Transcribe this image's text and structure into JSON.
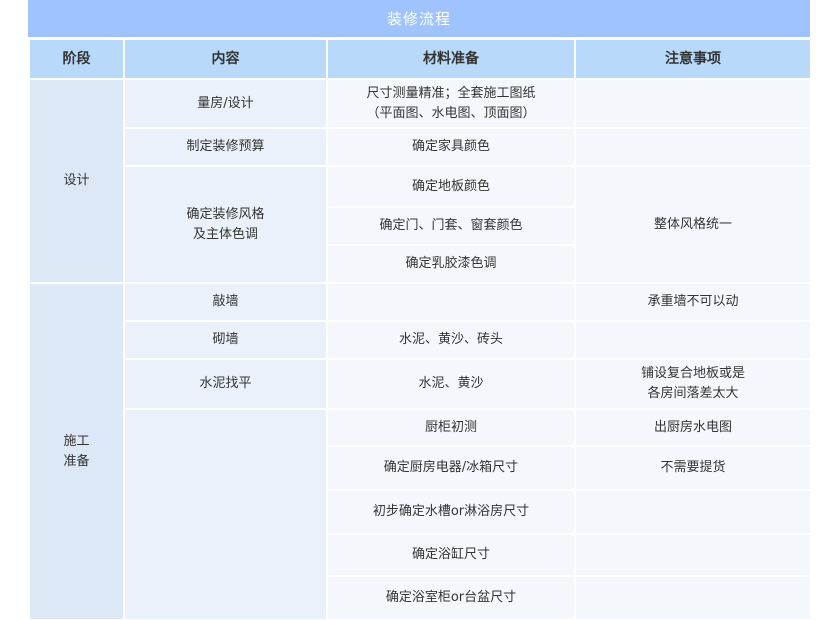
{
  "title": "装修流程",
  "headers": [
    "阶段",
    "内容",
    "材料准备",
    "注意事项"
  ],
  "design": {
    "stage": "设计",
    "rows": [
      {
        "content": "量房/设计",
        "material": "尺寸测量精准；全套施工图纸\n（平面图、水电图、顶面图）",
        "note": ""
      },
      {
        "content": "制定装修预算",
        "material": "确定家具颜色",
        "note": ""
      },
      {
        "content": "确定装修风格\n及主体色调",
        "materials": [
          "确定地板颜色",
          "确定门、门套、窗套颜色",
          "确定乳胶漆色调"
        ],
        "note": "整体风格统一"
      }
    ]
  },
  "construction": {
    "stage": "施工\n准备",
    "rows": [
      {
        "content": "敲墙",
        "material": "",
        "note": "承重墙不可以动"
      },
      {
        "content": "砌墙",
        "material": "水泥、黄沙、砖头",
        "note": ""
      },
      {
        "content": "水泥找平",
        "material": "水泥、黄沙",
        "note": "铺设复合地板或是\n各房间落差太大"
      },
      {
        "content": "",
        "material": "厨柜初测",
        "note": "出厨房水电图"
      },
      {
        "content": "",
        "material": "确定厨房电器/冰箱尺寸",
        "note": "不需要提货"
      },
      {
        "content": "",
        "material": "初步确定水槽or淋浴房尺寸",
        "note": ""
      },
      {
        "content": "",
        "material": "确定浴缸尺寸",
        "note": ""
      },
      {
        "content": "",
        "material": "确定浴室柜or台盆尺寸",
        "note": ""
      }
    ]
  }
}
